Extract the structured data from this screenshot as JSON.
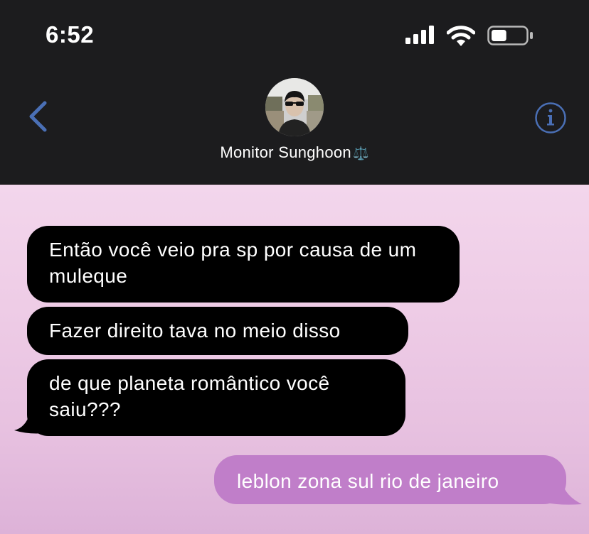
{
  "status_bar": {
    "time": "6:52",
    "icons": [
      "signal-icon",
      "wifi-icon",
      "battery-icon"
    ],
    "battery_level": 0.45
  },
  "header": {
    "contact_name": "Monitor Sunghoon",
    "name_emoji": "⚖️",
    "back_icon": "chevron-left-icon",
    "info_icon": "info-icon",
    "accent_color": "#4a6fb5"
  },
  "messages": [
    {
      "direction": "incoming",
      "text": "Então você veio pra sp por causa de um muleque"
    },
    {
      "direction": "incoming",
      "text": "Fazer direito tava no meio disso"
    },
    {
      "direction": "incoming",
      "text": "de que planeta romântico você saiu???"
    },
    {
      "direction": "outgoing",
      "text": "leblon zona sul rio de janeiro"
    }
  ],
  "colors": {
    "header_bg": "#1c1c1e",
    "incoming_bubble": "#000000",
    "outgoing_bubble": "#c07ec9",
    "chat_bg": "#eecce6"
  }
}
